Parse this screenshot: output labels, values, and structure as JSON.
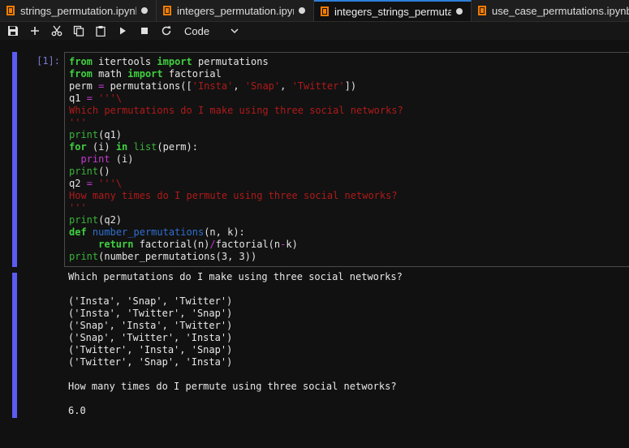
{
  "tabs": [
    {
      "label": "strings_permutation.ipynb",
      "active": false
    },
    {
      "label": "integers_permutation.ipynb",
      "active": false
    },
    {
      "label": "integers_strings_permutation.ipynb",
      "active": true
    },
    {
      "label": "use_case_permutations.ipynb",
      "active": false
    }
  ],
  "toolbar": {
    "icons": [
      "save-icon",
      "add-cell-icon",
      "cut-icon",
      "copy-icon",
      "paste-icon",
      "run-icon",
      "stop-icon",
      "restart-icon"
    ],
    "cell_type": "Code"
  },
  "cell": {
    "prompt": "[1]:",
    "code": {
      "l1": {
        "k1": "from",
        "t1": " itertools ",
        "k2": "import",
        "t2": " permutations"
      },
      "l2": {
        "k1": "from",
        "t1": " math ",
        "k2": "import",
        "t2": " factorial"
      },
      "l3": {
        "t1": "perm ",
        "o1": "=",
        "t2": " permutations([",
        "s1": "'Insta'",
        "t3": ", ",
        "s2": "'Snap'",
        "t4": ", ",
        "s3": "'Twitter'",
        "t5": "])"
      },
      "l4": {
        "t1": "q1 ",
        "o1": "=",
        "t2": " ",
        "s1": "'''\\"
      },
      "l5": {
        "s1": "Which permutations do I make using three social networks?"
      },
      "l6": {
        "s1": "'''"
      },
      "l7": {
        "b1": "print",
        "t1": "(q1)"
      },
      "l8": {
        "k1": "for",
        "t1": " (i) ",
        "k2": "in",
        "t2": " ",
        "b1": "list",
        "t3": "(perm):"
      },
      "l9": {
        "t0": "  ",
        "b1": "print",
        "t1": " (i)"
      },
      "l10": {
        "b1": "print",
        "t1": "()"
      },
      "l11": {
        "t1": "q2 ",
        "o1": "=",
        "t2": " ",
        "s1": "'''\\"
      },
      "l12": {
        "s1": "How many times do I permute using three social networks?"
      },
      "l13": {
        "s1": "'''"
      },
      "l14": {
        "b1": "print",
        "t1": "(q2)"
      },
      "l15": {
        "k1": "def",
        "t1": " ",
        "f1": "number_permutations",
        "t2": "(n, k):"
      },
      "l16": {
        "t0": "     ",
        "k1": "return",
        "t1": " factorial(n)",
        "o1": "/",
        "t2": "factorial(n",
        "o2": "-",
        "t3": "k)"
      },
      "l17": {
        "b1": "print",
        "t1": "(number_permutations(3, 3))"
      }
    },
    "output": [
      "Which permutations do I make using three social networks?",
      "",
      "('Insta', 'Snap', 'Twitter')",
      "('Insta', 'Twitter', 'Snap')",
      "('Snap', 'Insta', 'Twitter')",
      "('Snap', 'Twitter', 'Insta')",
      "('Twitter', 'Insta', 'Snap')",
      "('Twitter', 'Snap', 'Insta')",
      "",
      "How many times do I permute using three social networks?",
      "",
      "6.0"
    ]
  },
  "colors": {
    "accent": "#5b5cf3",
    "keyword": "#40d040",
    "string": "#b01a1a",
    "operator": "#c33ad0",
    "function": "#2f6fd0",
    "tab_active_border": "#2f7fd8"
  }
}
